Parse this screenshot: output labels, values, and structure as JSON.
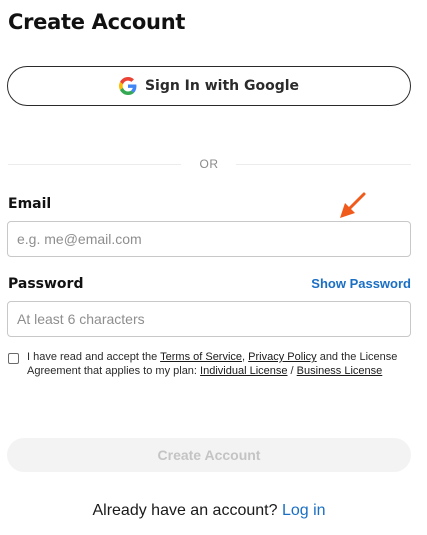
{
  "page": {
    "title": "Create Account"
  },
  "google": {
    "label": "Sign In with Google"
  },
  "divider": {
    "text": "OR"
  },
  "email": {
    "label": "Email",
    "placeholder": "e.g. me@email.com",
    "value": ""
  },
  "password": {
    "label": "Password",
    "placeholder": "At least 6 characters",
    "value": "",
    "show_label": "Show Password"
  },
  "terms": {
    "checked": false,
    "text_1": "I have read and accept the ",
    "tos_link": "Terms of Service",
    "text_2": ", ",
    "privacy_link": "Privacy Policy",
    "text_3": " and the License Agreement that applies to my plan: ",
    "individual_link": "Individual License",
    "text_4": " / ",
    "business_link": "Business License"
  },
  "submit": {
    "label": "Create Account",
    "enabled": false
  },
  "login": {
    "prompt": "Already have an account? ",
    "link": "Log in"
  },
  "colors": {
    "accent": "#1a6fc4",
    "arrow": "#f05a1a",
    "disabled_button_bg": "#f3f3f3",
    "disabled_button_text": "#c4c4c4"
  },
  "icons": {
    "google": "google-g-icon",
    "annotation": "arrow-pointer-icon"
  }
}
